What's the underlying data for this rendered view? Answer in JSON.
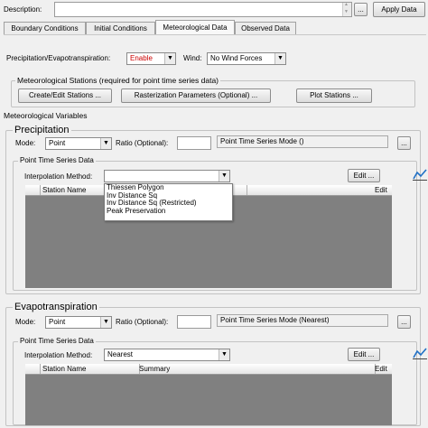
{
  "top": {
    "description_label": "Description:",
    "description_value": "",
    "ellipsis_label": "...",
    "apply_label": "Apply Data"
  },
  "tabs": [
    {
      "label": "Boundary Conditions"
    },
    {
      "label": "Initial Conditions"
    },
    {
      "label": "Meteorological Data"
    },
    {
      "label": "Observed Data"
    }
  ],
  "settings": {
    "precip_evap_label": "Precipitation/Evapotranspiration:",
    "precip_evap_value": "Enable",
    "precip_evap_color": "#cc0000",
    "wind_label": "Wind:",
    "wind_value": "No Wind Forces"
  },
  "stations": {
    "legend": "Meteorological Stations (required for point time series data)",
    "create_label": "Create/Edit Stations ...",
    "raster_label": "Rasterization Parameters (Optional) ...",
    "plot_label": "Plot Stations ..."
  },
  "met_vars_label": "Meteorological Variables",
  "precipitation": {
    "legend": "Precipitation",
    "mode_label": "Mode:",
    "mode_value": "Point",
    "ratio_label": "Ratio (Optional):",
    "ratio_value": "",
    "mode_display": "Point Time Series Mode ()",
    "browse_label": "...",
    "pts_legend": "Point Time Series Data",
    "interp_label": "Interpolation Method:",
    "interp_value": "",
    "edit_label": "Edit ...",
    "columns": [
      "Station Name",
      "Edit"
    ],
    "dropdown_options": [
      "Thiessen Polygon",
      "Inv Distance Sq",
      "Inv Distance Sq (Restricted)",
      "Peak Preservation"
    ]
  },
  "evapotranspiration": {
    "legend": "Evapotranspiration",
    "mode_label": "Mode:",
    "mode_value": "Point",
    "ratio_label": "Ratio (Optional):",
    "ratio_value": "",
    "mode_display": "Point Time Series Mode (Nearest)",
    "browse_label": "...",
    "pts_legend": "Point Time Series Data",
    "interp_label": "Interpolation Method:",
    "interp_value": "Nearest",
    "edit_label": "Edit ...",
    "columns": [
      "Station Name",
      "Summary",
      "Edit"
    ]
  },
  "icons": {
    "dropdown_arrow": "▼",
    "scroll_up": "▲",
    "scroll_down": "▼",
    "plot_icon": "line-chart-icon"
  }
}
